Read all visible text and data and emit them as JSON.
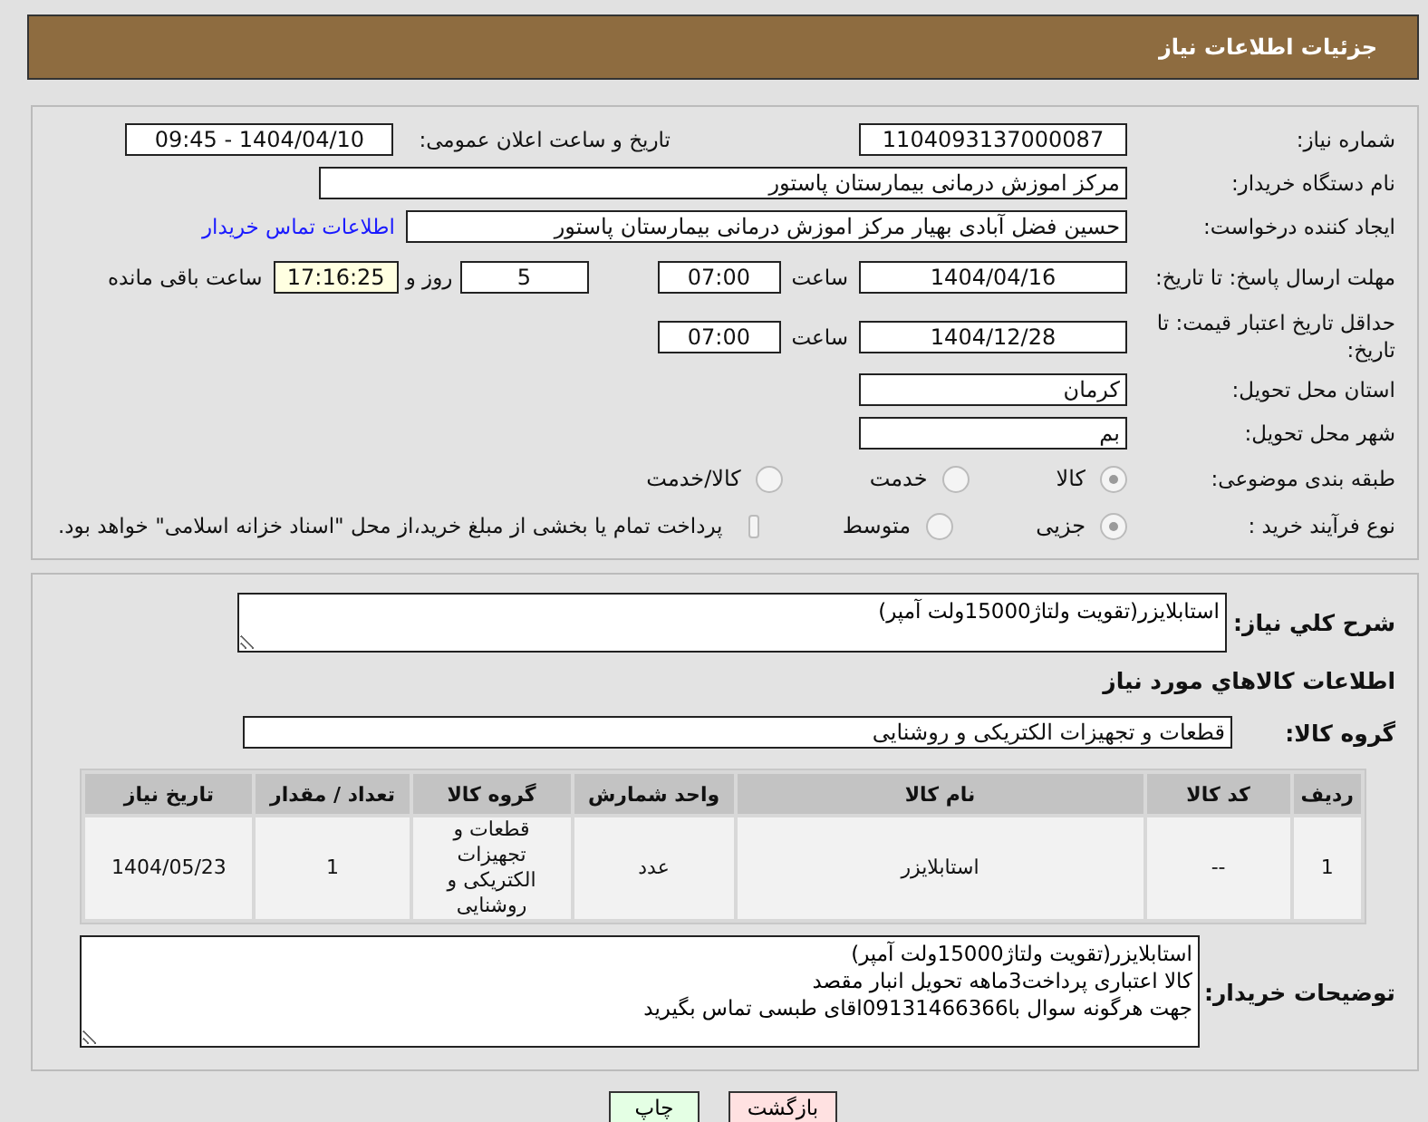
{
  "page_title": "جزئیات اطلاعات نیاز",
  "need_number": {
    "label": "شماره نیاز:",
    "value": "1104093137000087"
  },
  "announce": {
    "label": "تاریخ و ساعت اعلان عمومی:",
    "value": "1404/04/10 - 09:45"
  },
  "buyer_org": {
    "label": "نام دستگاه خریدار:",
    "value": "مرکز اموزش درمانی بیمارستان پاستور"
  },
  "requester": {
    "label": "ایجاد کننده درخواست:",
    "value": "حسین فضل آبادی بهیار مرکز اموزش درمانی بیمارستان پاستور",
    "link": "اطلاعات تماس خریدار"
  },
  "deadline": {
    "label": "مهلت ارسال پاسخ: تا تاریخ:",
    "date": "1404/04/16",
    "time_label": "ساعت",
    "time": "07:00",
    "days": "5",
    "days_label": "روز و",
    "remaining": "17:16:25",
    "remaining_label": "ساعت باقی مانده"
  },
  "price_validity": {
    "label": "حداقل تاریخ اعتبار قیمت: تا تاریخ:",
    "date": "1404/12/28",
    "time_label": "ساعت",
    "time": "07:00"
  },
  "province": {
    "label": "استان محل تحویل:",
    "value": "کرمان"
  },
  "city": {
    "label": "شهر محل تحویل:",
    "value": "بم"
  },
  "category": {
    "label": "طبقه بندی موضوعی:",
    "options": [
      {
        "label": "کالا",
        "selected": true
      },
      {
        "label": "خدمت",
        "selected": false
      },
      {
        "label": "کالا/خدمت",
        "selected": false
      }
    ]
  },
  "process": {
    "label": "نوع فرآیند خرید :",
    "options": [
      {
        "label": "جزیی",
        "selected": true
      },
      {
        "label": "متوسط",
        "selected": false
      }
    ],
    "payment": {
      "checked": false,
      "text": "پرداخت تمام یا بخشی از مبلغ خرید،از محل \"اسناد خزانه اسلامی\" خواهد بود."
    }
  },
  "summary": {
    "label": "شرح کلي نياز:",
    "value": "استابلایزر(تقویت ولتاژ15000ولت آمپر)"
  },
  "goods_heading": "اطلاعات کالاهاي مورد نياز",
  "goods_group": {
    "label": "گروه کالا:",
    "value": "قطعات و تجهیزات الکتریکی و روشنایی"
  },
  "table": {
    "columns": [
      "ردیف",
      "کد کالا",
      "نام کالا",
      "واحد شمارش",
      "گروه کالا",
      "تعداد / مقدار",
      "تاریخ نیاز"
    ],
    "rows": [
      {
        "cells": [
          "1",
          "--",
          "استابلایزر",
          "عدد",
          "قطعات و تجهیزات الکتریکی و روشنایی",
          "1",
          "1404/05/23"
        ]
      }
    ]
  },
  "buyer_notes": {
    "label": "توضیحات خریدار:",
    "lines": [
      "استابلایزر(تقویت ولتاژ15000ولت آمپر)",
      "کالا اعتباری پرداخت3ماهه تحویل انبار مقصد",
      "جهت هرگونه سوال با09131466366اقای طبسی تماس بگیرید"
    ]
  },
  "buttons": [
    {
      "label": "بازگشت",
      "kind": "back"
    },
    {
      "label": "چاپ",
      "kind": "print"
    }
  ]
}
